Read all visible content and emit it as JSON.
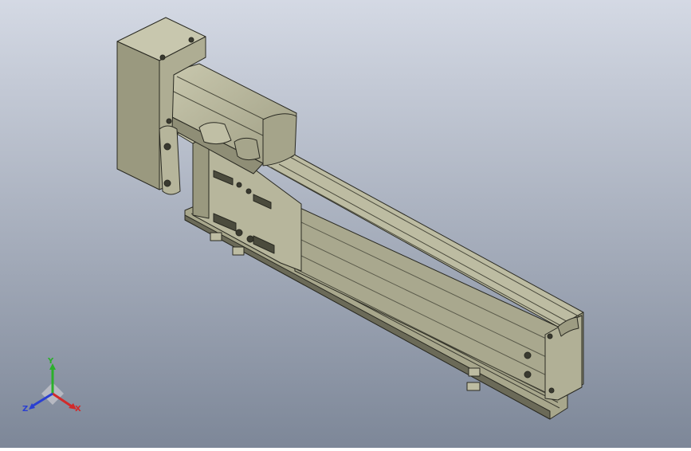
{
  "viewport": {
    "background_top": "#d4d9e4",
    "background_bottom": "#7d8798",
    "model_color": "#b8b79c"
  },
  "triad": {
    "x_label": "X",
    "y_label": "Y",
    "z_label": "Z",
    "x_color": "#d22a2a",
    "y_color": "#2bb02b",
    "z_color": "#2a3fd2"
  }
}
